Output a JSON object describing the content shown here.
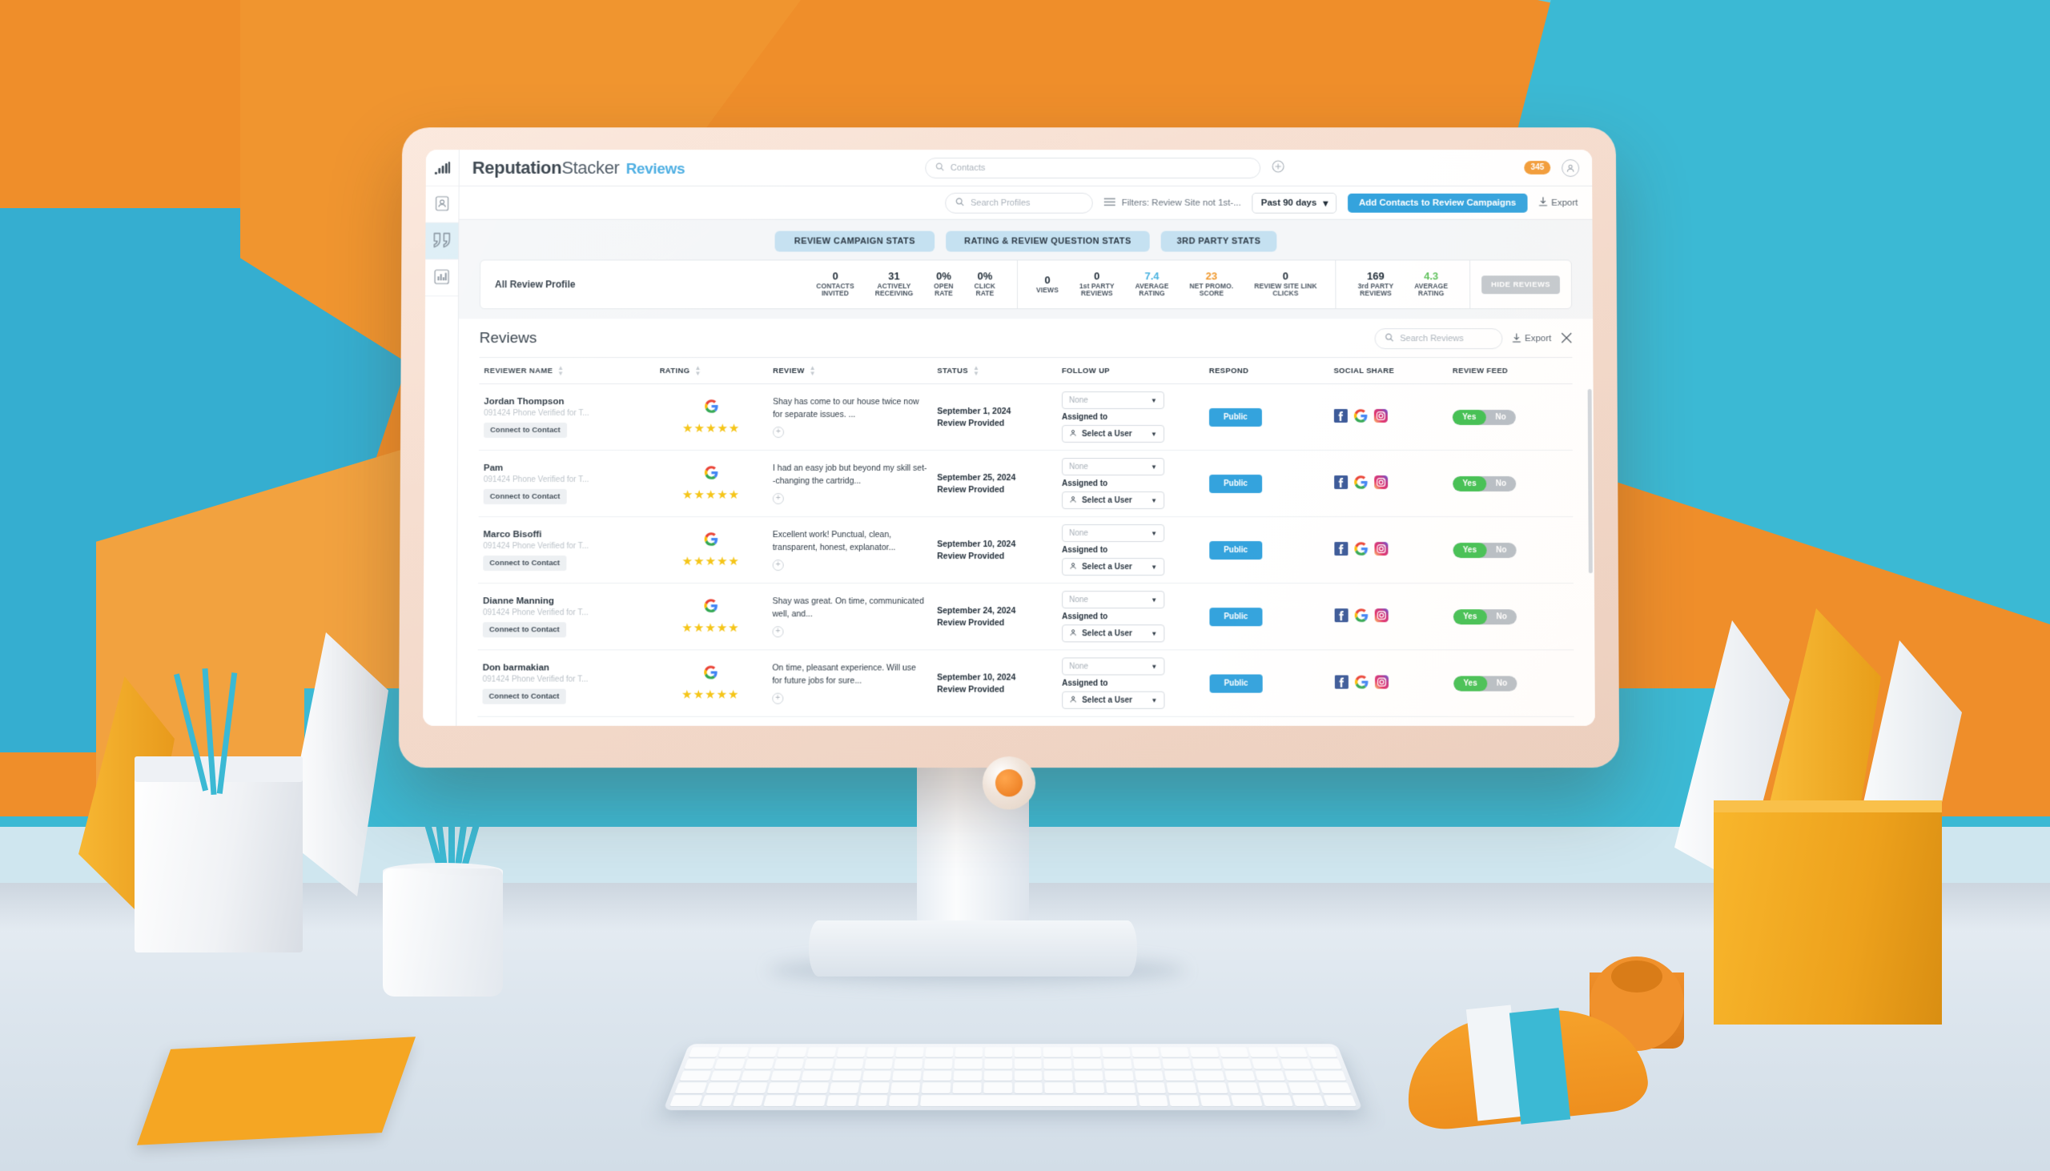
{
  "app": {
    "brand_bold": "Reputation",
    "brand_light": "Stacker",
    "section": "Reviews"
  },
  "rail": {
    "logo_icon": "bar-chart-logo-icon",
    "items": [
      {
        "icon": "contact-card-icon",
        "name": "contacts",
        "active": false
      },
      {
        "icon": "quotes-icon",
        "name": "reviews",
        "active": true
      },
      {
        "icon": "analytics-bar-icon",
        "name": "analytics",
        "active": false
      }
    ]
  },
  "topbar": {
    "contacts_search_placeholder": "Contacts",
    "add_icon": "plus-circle-icon",
    "notification_count": "345",
    "avatar_icon": "user-avatar-icon"
  },
  "filterbar": {
    "profiles_search_placeholder": "Search Profiles",
    "filters_icon": "filter-lines-icon",
    "filters_label": "Filters: Review Site not 1st-...",
    "date_range": "Past 90 days",
    "add_contacts_label": "Add Contacts to Review Campaigns",
    "export_label": "Export",
    "export_icon": "download-icon"
  },
  "stats": {
    "tabs": [
      {
        "label": "REVIEW CAMPAIGN STATS"
      },
      {
        "label": "RATING & REVIEW QUESTION STATS"
      },
      {
        "label": "3RD PARTY STATS"
      }
    ],
    "profile_label": "All Review Profile",
    "hide_reviews_label": "HIDE REVIEWS",
    "campaign": [
      {
        "value": "0",
        "label": "CONTACTS INVITED",
        "color": "#24303b"
      },
      {
        "value": "31",
        "label": "ACTIVELY RECEIVING",
        "color": "#24303b"
      },
      {
        "value": "0%",
        "label": "OPEN RATE",
        "color": "#24303b"
      },
      {
        "value": "0%",
        "label": "CLICK RATE",
        "color": "#24303b"
      }
    ],
    "rating": [
      {
        "value": "0",
        "label": "VIEWS",
        "color": "#24303b"
      },
      {
        "value": "0",
        "label": "1st PARTY REVIEWS",
        "color": "#24303b"
      },
      {
        "value": "7.4",
        "label": "AVERAGE RATING",
        "color": "#49b2e0"
      },
      {
        "value": "23",
        "label": "NET PROMO. SCORE",
        "color": "#f0982c"
      },
      {
        "value": "0",
        "label": "REVIEW SITE LINK CLICKS",
        "color": "#24303b"
      }
    ],
    "third_party": [
      {
        "value": "169",
        "label": "3rd PARTY REVIEWS",
        "color": "#24303b"
      },
      {
        "value": "4.3",
        "label": "AVERAGE RATING",
        "color": "#5fc15c"
      }
    ]
  },
  "reviews": {
    "title": "Reviews",
    "search_placeholder": "Search Reviews",
    "export_label": "Export",
    "close_icon": "close-icon",
    "columns": [
      {
        "label": "REVIEWER NAME",
        "sortable": true
      },
      {
        "label": "RATING",
        "sortable": true
      },
      {
        "label": "REVIEW",
        "sortable": true
      },
      {
        "label": "STATUS",
        "sortable": true
      },
      {
        "label": "FOLLOW UP",
        "sortable": false
      },
      {
        "label": "RESPOND",
        "sortable": false
      },
      {
        "label": "SOCIAL SHARE",
        "sortable": false
      },
      {
        "label": "REVIEW FEED",
        "sortable": false
      }
    ],
    "labels": {
      "connect_to_contact": "Connect to Contact",
      "assigned_to": "Assigned to",
      "followup_none": "None",
      "select_user": "Select a User",
      "respond_public": "Public",
      "toggle_yes": "Yes",
      "toggle_no": "No",
      "source_icon": "google-icon",
      "expand_icon": "plus-circle-icon",
      "social_icons": [
        "facebook-icon",
        "google-icon",
        "instagram-icon"
      ]
    },
    "rows": [
      {
        "name": "Jordan Thompson",
        "sub": "091424 Phone Verified for T...",
        "stars": 5,
        "review": "Shay has come to our house twice now for separate issues. ...",
        "date": "September 1, 2024",
        "status": "Review Provided",
        "feed": "yes"
      },
      {
        "name": "Pam",
        "sub": "091424 Phone Verified for T...",
        "stars": 5,
        "review": "I had an easy job but beyond my skill set--changing the cartridg...",
        "date": "September 25, 2024",
        "status": "Review Provided",
        "feed": "yes"
      },
      {
        "name": "Marco Bisoffi",
        "sub": "091424 Phone Verified for T...",
        "stars": 5,
        "review": "Excellent work! Punctual, clean, transparent, honest, explanator...",
        "date": "September 10, 2024",
        "status": "Review Provided",
        "feed": "yes"
      },
      {
        "name": "Dianne Manning",
        "sub": "091424 Phone Verified for T...",
        "stars": 5,
        "review": "Shay was great. On time, communicated well, and...",
        "date": "September 24, 2024",
        "status": "Review Provided",
        "feed": "yes"
      },
      {
        "name": "Don barmakian",
        "sub": "091424 Phone Verified for T...",
        "stars": 5,
        "review": "On time, pleasant experience. Will use for future jobs for sure...",
        "date": "September 10, 2024",
        "status": "Review Provided",
        "feed": "yes"
      }
    ]
  },
  "colors": {
    "accent_blue": "#34a3dd",
    "tab_blue": "#c5e1f1",
    "orange_badge": "#f29c38",
    "green_toggle": "#3fbf4f",
    "star_yellow": "#f5c518"
  }
}
